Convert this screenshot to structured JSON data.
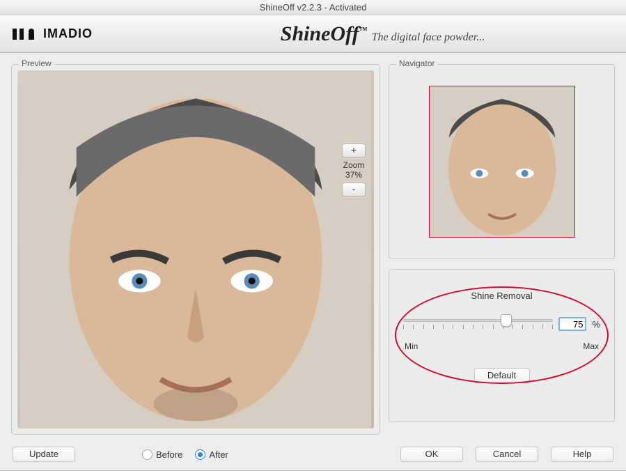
{
  "window": {
    "title": "ShineOff v2.2.3 - Activated"
  },
  "brand": {
    "company": "IMADIO",
    "product": "ShineOff",
    "tm": "™",
    "tagline": "The digital face powder..."
  },
  "preview": {
    "label": "Preview"
  },
  "zoom": {
    "plus": "+",
    "label": "Zoom",
    "value": "37%",
    "minus": "-"
  },
  "navigator": {
    "label": "Navigator"
  },
  "shine": {
    "title": "Shine Removal",
    "min": "Min",
    "max": "Max",
    "value": "75",
    "pct": "%",
    "default_btn": "Default"
  },
  "footer": {
    "update": "Update",
    "before": "Before",
    "after": "After",
    "ok": "OK",
    "cancel": "Cancel",
    "help": "Help",
    "selected_view": "after"
  }
}
